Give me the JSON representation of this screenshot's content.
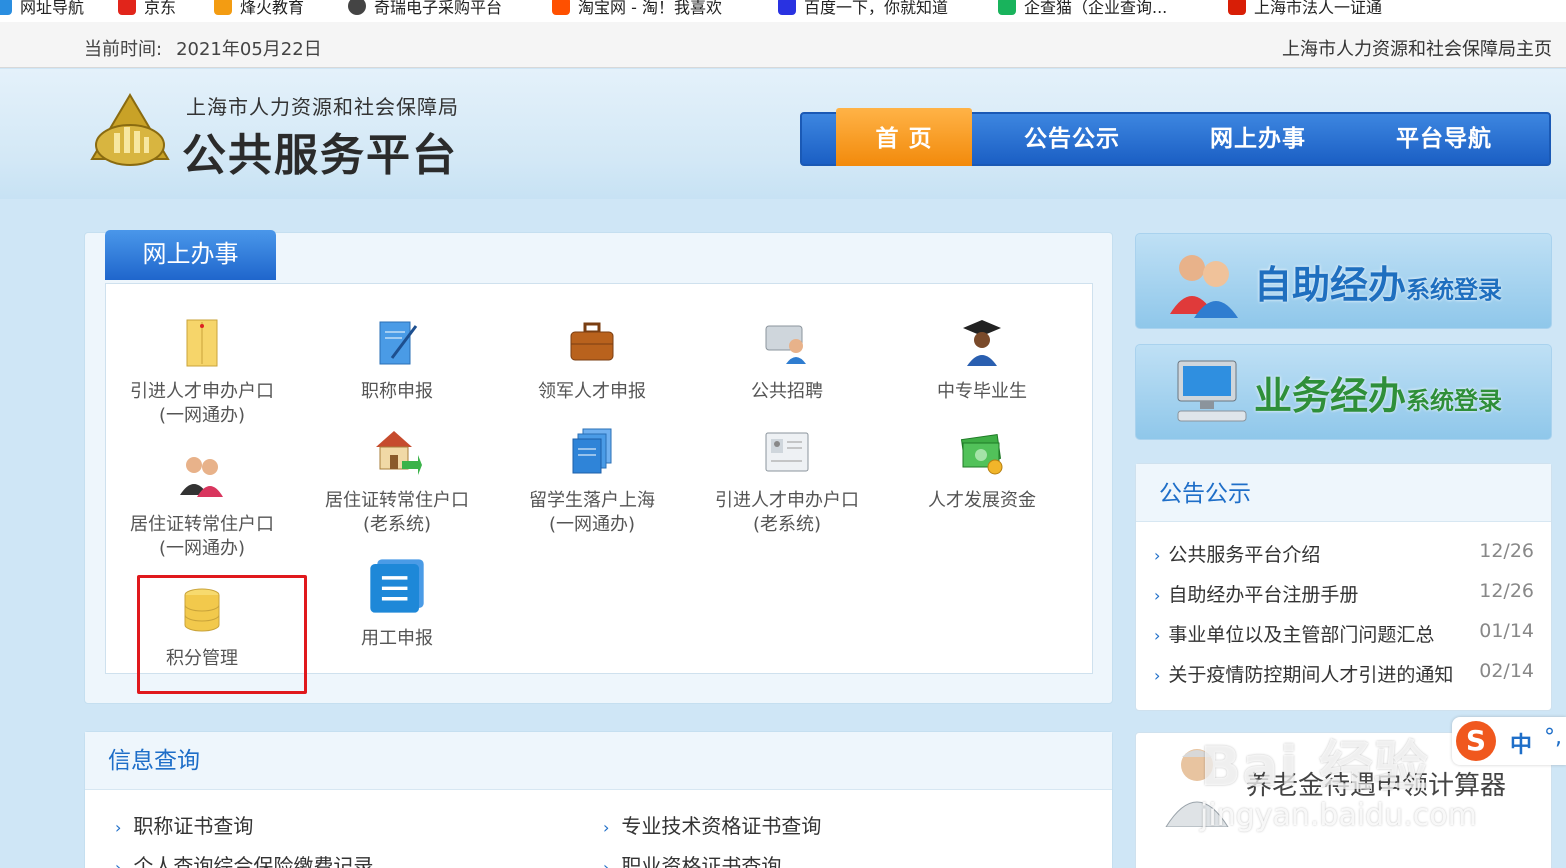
{
  "bookmarks": [
    "网址导航",
    "京东",
    "烽火教育",
    "奇瑞电子采购平台",
    "淘宝网 - 淘！我喜欢",
    "百度一下，你就知道",
    "企查猫（企业查询...",
    "上海市法人一证通"
  ],
  "topbar": {
    "time_label": "当前时间:",
    "date": "2021年05月22日",
    "home_link": "上海市人力资源和社会保障局主页"
  },
  "header": {
    "org_name": "上海市人力资源和社会保障局",
    "platform_name": "公共服务平台"
  },
  "nav": [
    "首 页",
    "公告公示",
    "网上办事",
    "平台导航"
  ],
  "online_services": {
    "tab_label": "网上办事",
    "items": [
      {
        "label": "引进人才申办户口",
        "sub": "(一网通办)",
        "icon": "envelope-icon"
      },
      {
        "label": "职称申报",
        "sub": "",
        "icon": "document-pen-icon"
      },
      {
        "label": "领军人才申报",
        "sub": "",
        "icon": "briefcase-icon"
      },
      {
        "label": "公共招聘",
        "sub": "",
        "icon": "recruiter-icon"
      },
      {
        "label": "中专毕业生",
        "sub": "",
        "icon": "graduate-icon"
      },
      {
        "label": "居住证转常住户口",
        "sub": "(一网通办)",
        "icon": "couple-icon"
      },
      {
        "label": "居住证转常住户口",
        "sub": "(老系统)",
        "icon": "house-arrow-icon"
      },
      {
        "label": "留学生落户上海",
        "sub": "(一网通办)",
        "icon": "files-icon"
      },
      {
        "label": "引进人才申办户口",
        "sub": "(老系统)",
        "icon": "id-card-icon"
      },
      {
        "label": "人才发展资金",
        "sub": "",
        "icon": "money-icon"
      },
      {
        "label": "积分管理",
        "sub": "",
        "icon": "database-icon"
      },
      {
        "label": "用工申报",
        "sub": "",
        "icon": "list-icon"
      }
    ]
  },
  "banners": {
    "self_service": {
      "main": "自助经办",
      "small": "系统登录"
    },
    "business": {
      "main": "业务经办",
      "small": "系统登录"
    }
  },
  "announcements": {
    "title": "公告公示",
    "items": [
      {
        "text": "公共服务平台介绍",
        "date": "12/26"
      },
      {
        "text": "自助经办平台注册手册",
        "date": "12/26"
      },
      {
        "text": "事业单位以及主管部门问题汇总",
        "date": "01/14"
      },
      {
        "text": "关于疫情防控期间人才引进的通知",
        "date": "02/14"
      }
    ]
  },
  "calculator": {
    "title": "养老金待遇申领计算器"
  },
  "info_query": {
    "title": "信息查询",
    "links": [
      "职称证书查询",
      "专业技术资格证书查询",
      "个人查询综合保险缴费记录",
      "职业资格证书查询"
    ]
  },
  "watermark": {
    "main": "Bai 经验",
    "url": "jingyan.baidu.com"
  },
  "ime": {
    "logo": "S",
    "mode": "中",
    "punct": "°,"
  }
}
